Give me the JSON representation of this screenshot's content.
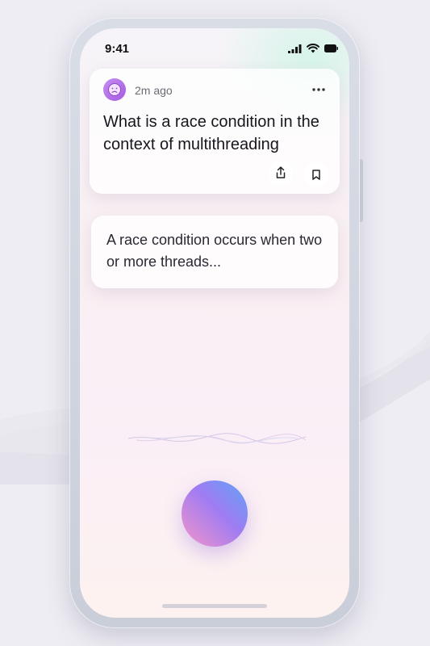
{
  "status_bar": {
    "time": "9:41"
  },
  "question_card": {
    "time_ago": "2m ago",
    "question": "What is a race condition in the context of multithreading",
    "more_icon": "more-horizontal-icon",
    "share_icon": "share-icon",
    "bookmark_icon": "bookmark-icon"
  },
  "answer_card": {
    "answer": "A race condition occurs when two or more threads..."
  },
  "voice": {
    "orb_icon": "voice-orb"
  },
  "colors": {
    "accent_purple": "#a65be0",
    "orb_blue": "#5fa4f6",
    "orb_pink": "#f595c9"
  }
}
